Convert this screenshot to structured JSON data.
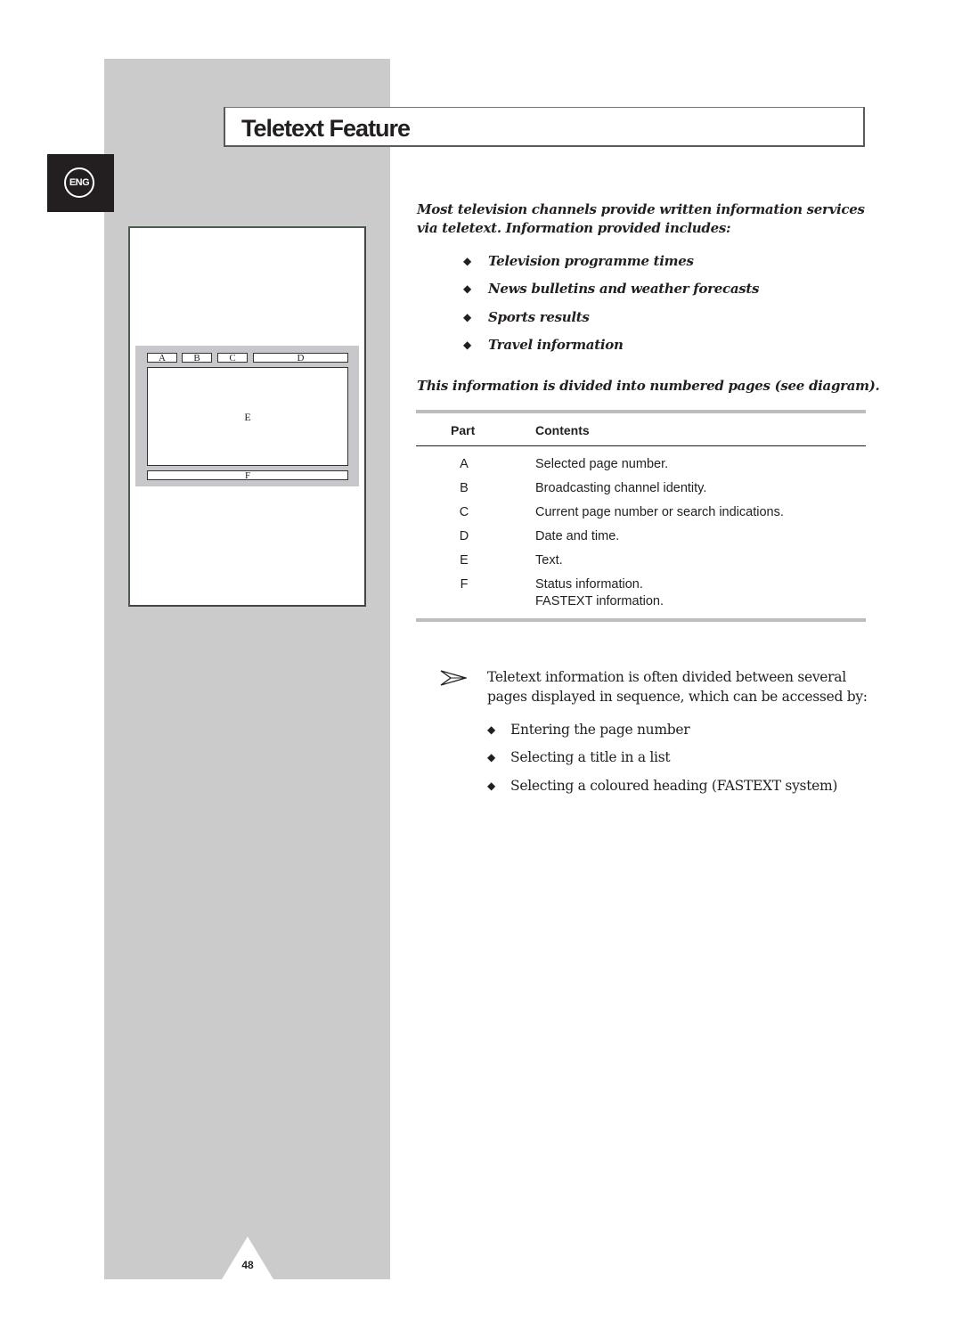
{
  "language_tab": "ENG",
  "title": "Teletext Feature",
  "diagram": {
    "labels": {
      "a": "A",
      "b": "B",
      "c": "C",
      "d": "D",
      "e": "E",
      "f": "F"
    }
  },
  "intro": {
    "paragraph": "Most television channels provide written information services via teletext. Information provided includes:",
    "items": [
      "Television programme times",
      "News bulletins and weather forecasts",
      "Sports results",
      "Travel information"
    ],
    "divided_note": "This information is divided into numbered pages (see diagram)."
  },
  "table": {
    "headers": {
      "part": "Part",
      "contents": "Contents"
    },
    "rows": [
      {
        "part": "A",
        "contents": "Selected page number."
      },
      {
        "part": "B",
        "contents": "Broadcasting channel identity."
      },
      {
        "part": "C",
        "contents": "Current page number or search indications."
      },
      {
        "part": "D",
        "contents": "Date and time."
      },
      {
        "part": "E",
        "contents": "Text."
      },
      {
        "part": "F",
        "contents": "Status information.",
        "contents2": "FASTEXT information."
      }
    ]
  },
  "note": {
    "icon": "arrow-note-icon",
    "text": "Teletext information is often divided between several pages displayed in sequence, which can be accessed by:",
    "items": [
      "Entering the page number",
      "Selecting a title in a list",
      "Selecting a coloured heading (FASTEXT system)"
    ]
  },
  "bullet_glyph": "◆",
  "page_number": "48"
}
